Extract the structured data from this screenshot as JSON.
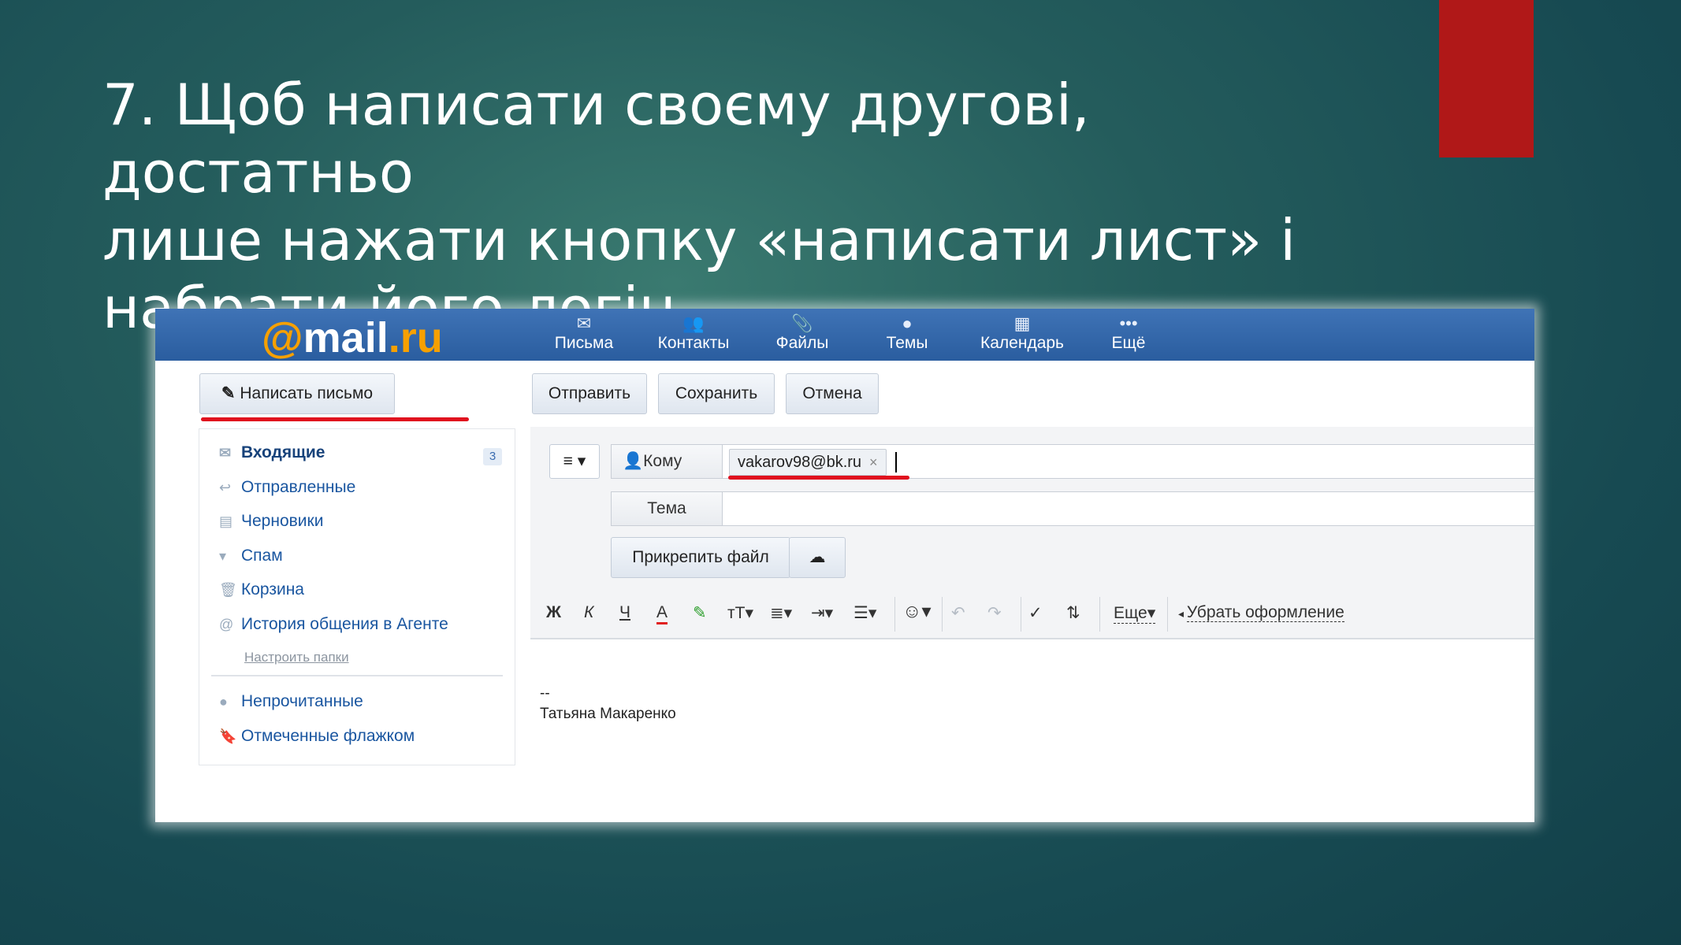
{
  "slide": {
    "title_lines": [
      "7. Щоб написати своєму другові, достатньо",
      "лише нажати кнопку «написати лист» і",
      "набрати його логін."
    ],
    "accent_color": "#b01818"
  },
  "mail": {
    "logo": {
      "at": "@",
      "name": "mail",
      "dot_ru": ".ru"
    },
    "nav": [
      {
        "label": "Письма",
        "icon": "envelope-icon"
      },
      {
        "label": "Контакты",
        "icon": "contacts-icon"
      },
      {
        "label": "Файлы",
        "icon": "paperclip-icon"
      },
      {
        "label": "Темы",
        "icon": "palette-icon"
      },
      {
        "label": "Календарь",
        "icon": "calendar-icon"
      },
      {
        "label": "Ещё",
        "icon": "more-dots-icon"
      }
    ],
    "compose_button": "Написать письмо",
    "actions": {
      "send": "Отправить",
      "save": "Сохранить",
      "cancel": "Отмена"
    },
    "folders": [
      {
        "label": "Входящие",
        "icon": "inbox-icon",
        "count": "3"
      },
      {
        "label": "Отправленные",
        "icon": "reply-icon"
      },
      {
        "label": "Черновики",
        "icon": "draft-icon"
      },
      {
        "label": "Спам",
        "icon": "thumbs-down-icon"
      },
      {
        "label": "Корзина",
        "icon": "trash-icon"
      },
      {
        "label": "История общения в Агенте",
        "icon": "at-icon"
      }
    ],
    "configure_folders": "Настроить папки",
    "filters": [
      {
        "label": "Непрочитанные",
        "icon": "dot-icon"
      },
      {
        "label": "Отмеченные флажком",
        "icon": "flag-icon"
      }
    ],
    "to_label": "Кому",
    "recipient": "vakarov98@bk.ru",
    "subject_label": "Тема",
    "attach_label": "Прикрепить файл",
    "toolbar": {
      "bold": "Ж",
      "italic": "К",
      "underline": "Ч",
      "text_color": "А",
      "font_size": "тТ",
      "more": "Еще",
      "clear_format": "Убрать оформление"
    },
    "signature_dash": "--",
    "signature_name": "Татьяна Макаренко"
  }
}
